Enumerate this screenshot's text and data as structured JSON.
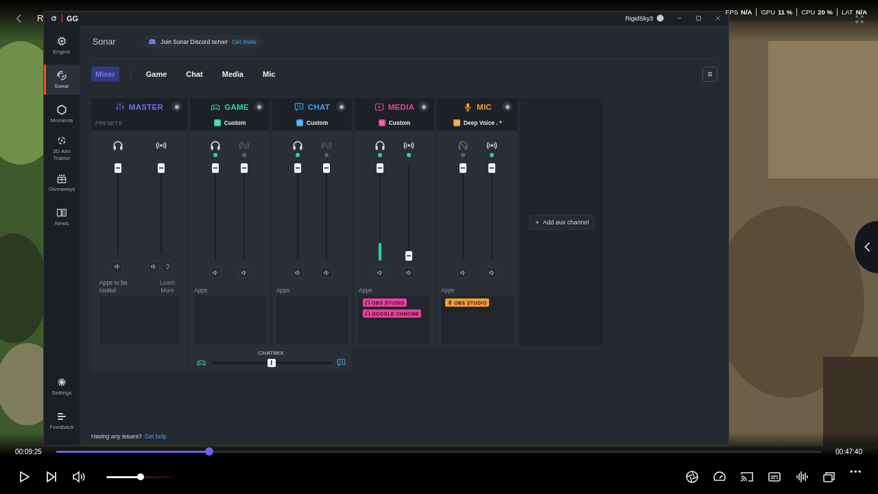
{
  "video": {
    "title": "R",
    "stats": [
      {
        "label": "FPS",
        "value": "N/A"
      },
      {
        "label": "GPU",
        "value": "11 %"
      },
      {
        "label": "CPU",
        "value": "20 %"
      },
      {
        "label": "LAT",
        "value": "N/A"
      }
    ],
    "elapsed": "00:09:25",
    "duration": "00:47:40",
    "progress": {
      "level": 0.2
    },
    "volume": {
      "level": 0.5
    }
  },
  "window": {
    "title": "GG",
    "user": "RigidSky3"
  },
  "sidebar": {
    "items": [
      {
        "kind": "engine",
        "label": "Engine",
        "selected": false
      },
      {
        "kind": "sonar",
        "label": "Sonar",
        "selected": true
      },
      {
        "kind": "moments",
        "label": "Moments",
        "selected": false
      },
      {
        "kind": "aim",
        "label": "3D Aim Trainer",
        "selected": false
      },
      {
        "kind": "giveaways",
        "label": "Giveaways",
        "selected": false
      },
      {
        "kind": "news",
        "label": "News",
        "selected": false
      }
    ],
    "bottom_items": [
      {
        "kind": "settings",
        "label": "Settings"
      },
      {
        "kind": "feedback",
        "label": "Feedback"
      }
    ]
  },
  "header": {
    "title": "Sonar",
    "invite_text": "Join Sonar Discord server",
    "invite_link": "Get invite"
  },
  "tabs": [
    {
      "label": "Mixer",
      "selected": true
    },
    {
      "label": "Game",
      "selected": false
    },
    {
      "label": "Chat",
      "selected": false
    },
    {
      "label": "Media",
      "selected": false
    },
    {
      "label": "Mic",
      "selected": false
    }
  ],
  "channels": [
    {
      "kind": "master",
      "name": "MASTER",
      "color": "#6b6ef5",
      "presets_label": "PRESETS",
      "sliders": [
        {
          "kind": "headphone",
          "level": 1,
          "buttons": [
            {
              "kind": "mute"
            }
          ]
        },
        {
          "kind": "stream",
          "level": 1,
          "buttons": [
            {
              "kind": "mute"
            },
            {
              "kind": "ear"
            }
          ]
        }
      ],
      "apps_label": "Apps to be routed",
      "learn_more": "Learn More"
    },
    {
      "kind": "game",
      "name": "GAME",
      "color": "#2fd3a1",
      "preset": "Custom",
      "sliders": [
        {
          "kind": "headphone",
          "on": true,
          "level": 1,
          "buttons": [
            {
              "kind": "mute"
            }
          ]
        },
        {
          "kind": "stream",
          "on": false,
          "level": 1,
          "buttons": [
            {
              "kind": "mute"
            }
          ]
        }
      ],
      "apps_label": "Apps"
    },
    {
      "kind": "chat",
      "name": "CHAT",
      "color": "#3aa6e6",
      "preset": "Custom",
      "sliders": [
        {
          "kind": "headphone",
          "on": true,
          "level": 1,
          "buttons": [
            {
              "kind": "mute"
            }
          ]
        },
        {
          "kind": "stream",
          "on": false,
          "level": 1,
          "buttons": [
            {
              "kind": "mute"
            }
          ]
        }
      ],
      "apps_label": "Apps"
    },
    {
      "kind": "media",
      "name": "MEDIA",
      "color": "#e8409f",
      "preset": "Custom",
      "sliders": [
        {
          "kind": "headphone",
          "on": true,
          "level": 1,
          "meter": {
            "level": 0.18
          },
          "buttons": [
            {
              "kind": "mute"
            }
          ]
        },
        {
          "kind": "stream",
          "on": true,
          "level": 0,
          "buttons": [
            {
              "kind": "mute"
            }
          ]
        }
      ],
      "apps_label": "Apps",
      "apps": [
        {
          "kind": "headphone",
          "label": "OBS STUDIO"
        },
        {
          "kind": "headphone",
          "label": "GOOGLE CHROME"
        }
      ]
    },
    {
      "kind": "mic",
      "name": "MIC",
      "color": "#f0a035",
      "preset": "Deep Voice . *",
      "sliders": [
        {
          "kind": "headphone",
          "on": false,
          "level": 1,
          "buttons": [
            {
              "kind": "mute"
            }
          ]
        },
        {
          "kind": "stream",
          "on": true,
          "level": 1,
          "buttons": [
            {
              "kind": "mute"
            }
          ]
        }
      ],
      "apps_label": "Apps",
      "apps": [
        {
          "kind": "mic",
          "label": "OBS STUDIO"
        }
      ]
    }
  ],
  "aux_button": "Add aux channel",
  "chatmix": {
    "label": "CHATMIX",
    "level": 0.5
  },
  "footer": {
    "text": "Having any issues?",
    "link": "Get help"
  }
}
